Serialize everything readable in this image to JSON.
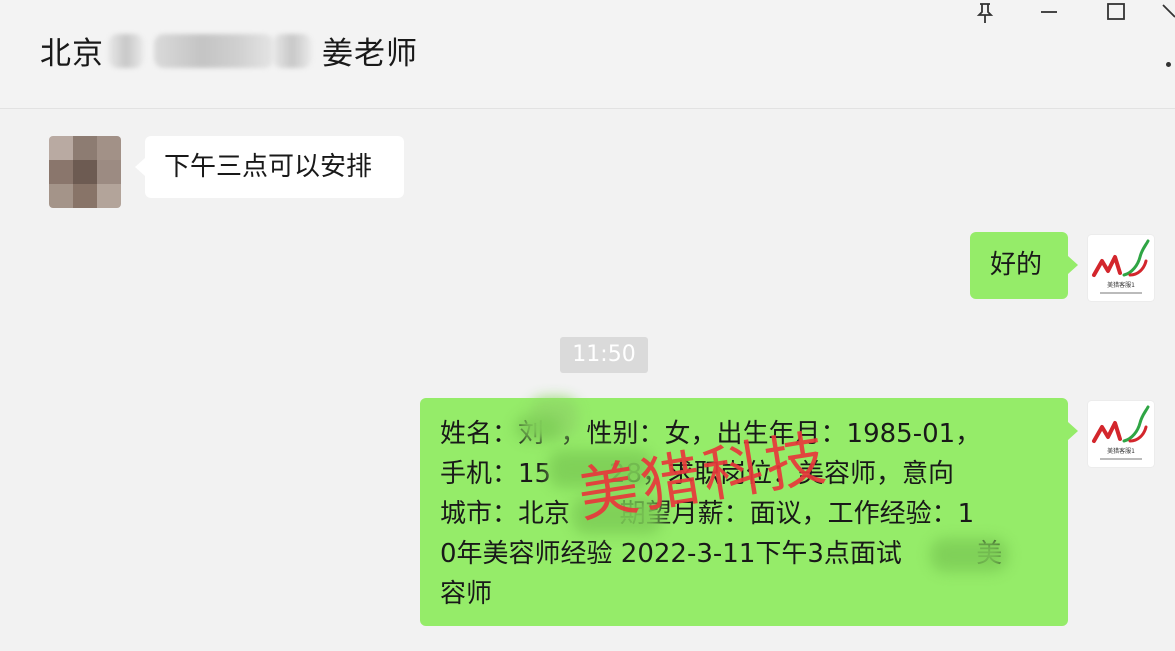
{
  "header": {
    "title_prefix": "北京",
    "title_suffix": "姜老师",
    "pin_icon_glyph": "⊥",
    "minimize_glyph": "—",
    "maximize_glyph": "☐",
    "close_glyph": "✕"
  },
  "messages": [
    {
      "side": "left",
      "text": "下午三点可以安排"
    },
    {
      "side": "right",
      "text": "好的"
    }
  ],
  "timestamp": "11:50",
  "resume_message": {
    "side": "right",
    "text": "姓名：刘  ，性别：女，出生年月：1985-01，\n手机：15       28，求职岗位：美容师，意向\n城市：北京      期望月薪：面议，工作经验：1\n0年美容师经验 2022-3-11下午3点面试         美\n容师"
  },
  "watermark": "美猎科技",
  "logo": {
    "caption": "美猎客服1"
  },
  "colors": {
    "green_bubble": "#95ec69",
    "white_bubble": "#ffffff",
    "background": "#f2f2f2",
    "watermark": "#e8383b",
    "logo_red": "#d3262c",
    "logo_green": "#2fa544"
  }
}
